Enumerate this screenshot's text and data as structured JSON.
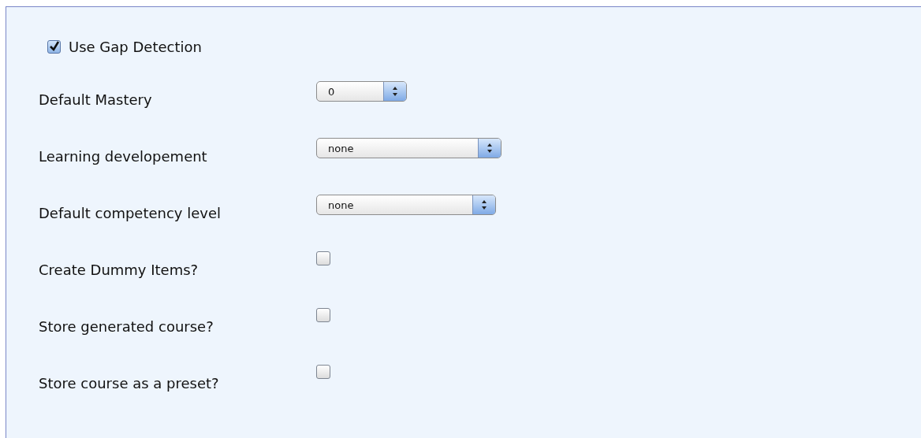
{
  "gap_detection": {
    "label": "Use Gap Detection",
    "checked": true
  },
  "fields": [
    {
      "kind": "select",
      "label": "Default Mastery",
      "value": "0"
    },
    {
      "kind": "select",
      "label": "Learning developement",
      "value": "none"
    },
    {
      "kind": "select",
      "label": "Default competency level",
      "value": "none"
    },
    {
      "kind": "checkbox",
      "label": "Create Dummy Items?",
      "checked": false
    },
    {
      "kind": "checkbox",
      "label": "Store generated course?",
      "checked": false
    },
    {
      "kind": "checkbox",
      "label": "Store course as a preset?",
      "checked": false
    }
  ]
}
